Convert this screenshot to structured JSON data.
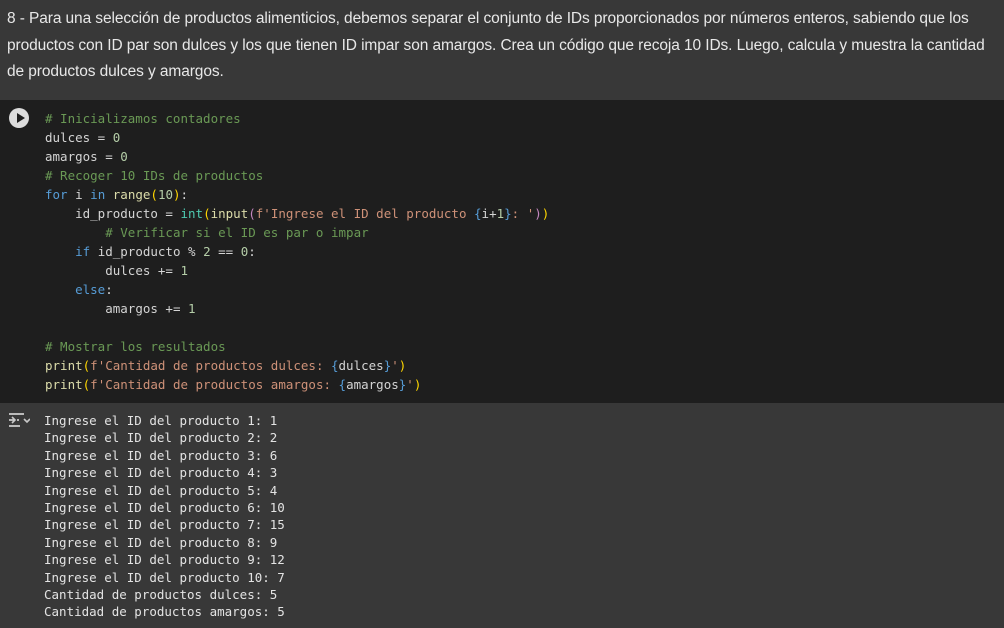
{
  "markdown": {
    "text": "8 - Para una selección de productos alimenticios, debemos separar el conjunto de IDs proporcionados por números enteros, sabiendo que los productos con ID par son dulces y los que tienen ID impar son amargos. Crea un código que recoja 10 IDs. Luego, calcula y muestra la cantidad de productos dulces y amargos."
  },
  "code": {
    "comment1": "# Inicializamos contadores",
    "var_dulces": "dulces",
    "var_amargos": "amargos",
    "zero": "0",
    "comment2": "# Recoger 10 IDs de productos",
    "kw_for": "for",
    "kw_in": "in",
    "fn_range": "range",
    "ten": "10",
    "var_i": "i",
    "var_id": "id_producto",
    "fn_int": "int",
    "fn_input": "input",
    "str_input_a": "f'Ingrese el ID del producto ",
    "str_input_b": ": '",
    "one": "1",
    "comment3": "# Verificar si el ID es par o impar",
    "kw_if": "if",
    "two": "2",
    "kw_else": "else",
    "comment4": "# Mostrar los resultados",
    "fn_print": "print",
    "str_dulces_a": "f'Cantidad de productos dulces: ",
    "str_amargos_a": "f'Cantidad de productos amargos: ",
    "str_end": "'"
  },
  "output": {
    "lines": [
      "Ingrese el ID del producto 1: 1",
      "Ingrese el ID del producto 2: 2",
      "Ingrese el ID del producto 3: 6",
      "Ingrese el ID del producto 4: 3",
      "Ingrese el ID del producto 5: 4",
      "Ingrese el ID del producto 6: 10",
      "Ingrese el ID del producto 7: 15",
      "Ingrese el ID del producto 8: 9",
      "Ingrese el ID del producto 9: 12",
      "Ingrese el ID del producto 10: 7",
      "Cantidad de productos dulces: 5",
      "Cantidad de productos amargos: 5"
    ]
  },
  "icons": {
    "run": "play-icon",
    "output": "output-toggle-icon"
  }
}
